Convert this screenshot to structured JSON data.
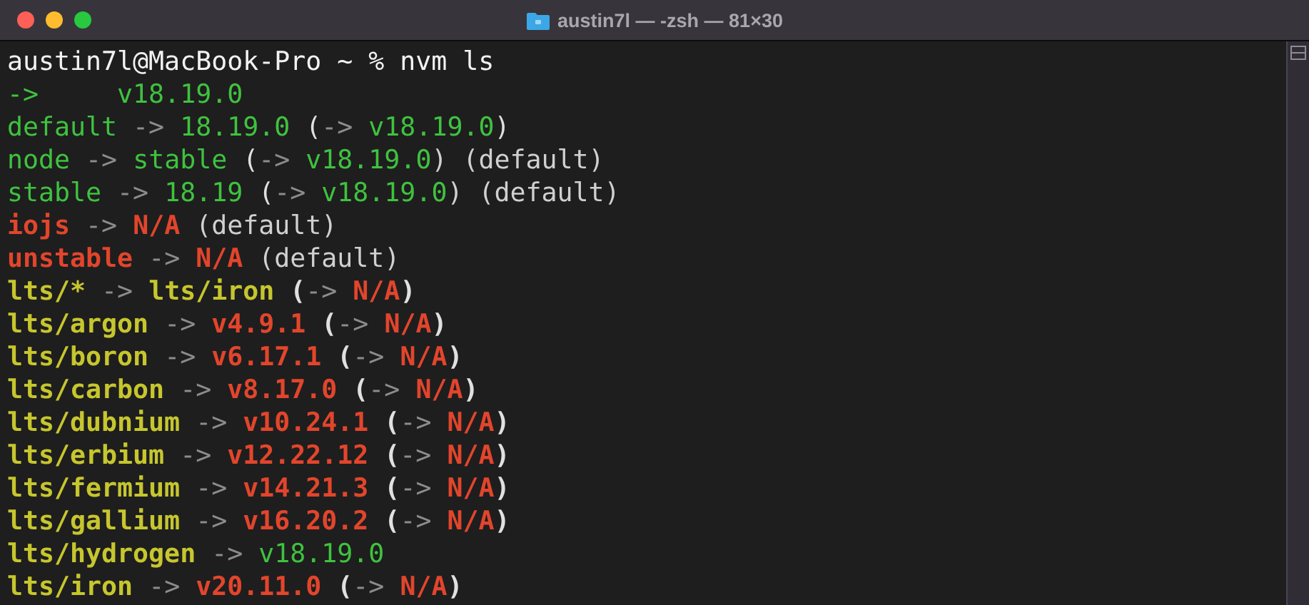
{
  "window": {
    "title": "austin7l — -zsh — 81×30"
  },
  "lines": [
    [
      {
        "text": "austin7l@MacBook-Pro ~ % nvm ls",
        "color": "#f2f2f2",
        "bold": false
      }
    ],
    [
      {
        "text": "->     v18.19.0",
        "color": "#3fc23f",
        "bold": false
      }
    ],
    [
      {
        "text": "default",
        "color": "#3fc23f",
        "bold": false
      },
      {
        "text": " -> ",
        "color": "#8c8c8c",
        "bold": false
      },
      {
        "text": "18.19.0",
        "color": "#3fc23f",
        "bold": false
      },
      {
        "text": " (",
        "color": "#e0e0e0",
        "bold": false
      },
      {
        "text": "-> ",
        "color": "#8c8c8c",
        "bold": false
      },
      {
        "text": "v18.19.0",
        "color": "#3fc23f",
        "bold": false
      },
      {
        "text": ")",
        "color": "#e0e0e0",
        "bold": false
      }
    ],
    [
      {
        "text": "node",
        "color": "#3fc23f",
        "bold": false
      },
      {
        "text": " -> ",
        "color": "#8c8c8c",
        "bold": false
      },
      {
        "text": "stable",
        "color": "#3fc23f",
        "bold": false
      },
      {
        "text": " (",
        "color": "#e0e0e0",
        "bold": false
      },
      {
        "text": "-> ",
        "color": "#8c8c8c",
        "bold": false
      },
      {
        "text": "v18.19.0",
        "color": "#3fc23f",
        "bold": false
      },
      {
        "text": ") (default)",
        "color": "#d0d0d0",
        "bold": false
      }
    ],
    [
      {
        "text": "stable",
        "color": "#3fc23f",
        "bold": false
      },
      {
        "text": " -> ",
        "color": "#8c8c8c",
        "bold": false
      },
      {
        "text": "18.19",
        "color": "#3fc23f",
        "bold": false
      },
      {
        "text": " (",
        "color": "#e0e0e0",
        "bold": false
      },
      {
        "text": "-> ",
        "color": "#8c8c8c",
        "bold": false
      },
      {
        "text": "v18.19.0",
        "color": "#3fc23f",
        "bold": false
      },
      {
        "text": ") (default)",
        "color": "#d0d0d0",
        "bold": false
      }
    ],
    [
      {
        "text": "iojs",
        "color": "#e2452c",
        "bold": true
      },
      {
        "text": " -> ",
        "color": "#8c8c8c",
        "bold": false
      },
      {
        "text": "N/A",
        "color": "#e2452c",
        "bold": true
      },
      {
        "text": " (default)",
        "color": "#d0d0d0",
        "bold": false
      }
    ],
    [
      {
        "text": "unstable",
        "color": "#e2452c",
        "bold": true
      },
      {
        "text": " -> ",
        "color": "#8c8c8c",
        "bold": false
      },
      {
        "text": "N/A",
        "color": "#e2452c",
        "bold": true
      },
      {
        "text": " (default)",
        "color": "#d0d0d0",
        "bold": false
      }
    ],
    [
      {
        "text": "lts/*",
        "color": "#c6c62e",
        "bold": true
      },
      {
        "text": " -> ",
        "color": "#8c8c8c",
        "bold": false
      },
      {
        "text": "lts/iron",
        "color": "#c6c62e",
        "bold": true
      },
      {
        "text": " (",
        "color": "#e0e0e0",
        "bold": true
      },
      {
        "text": "-> ",
        "color": "#8c8c8c",
        "bold": false
      },
      {
        "text": "N/A",
        "color": "#e2452c",
        "bold": true
      },
      {
        "text": ")",
        "color": "#e0e0e0",
        "bold": true
      }
    ],
    [
      {
        "text": "lts/argon",
        "color": "#c6c62e",
        "bold": true
      },
      {
        "text": " -> ",
        "color": "#8c8c8c",
        "bold": false
      },
      {
        "text": "v4.9.1",
        "color": "#e2452c",
        "bold": true
      },
      {
        "text": " (",
        "color": "#e0e0e0",
        "bold": true
      },
      {
        "text": "-> ",
        "color": "#8c8c8c",
        "bold": false
      },
      {
        "text": "N/A",
        "color": "#e2452c",
        "bold": true
      },
      {
        "text": ")",
        "color": "#e0e0e0",
        "bold": true
      }
    ],
    [
      {
        "text": "lts/boron",
        "color": "#c6c62e",
        "bold": true
      },
      {
        "text": " -> ",
        "color": "#8c8c8c",
        "bold": false
      },
      {
        "text": "v6.17.1",
        "color": "#e2452c",
        "bold": true
      },
      {
        "text": " (",
        "color": "#e0e0e0",
        "bold": true
      },
      {
        "text": "-> ",
        "color": "#8c8c8c",
        "bold": false
      },
      {
        "text": "N/A",
        "color": "#e2452c",
        "bold": true
      },
      {
        "text": ")",
        "color": "#e0e0e0",
        "bold": true
      }
    ],
    [
      {
        "text": "lts/carbon",
        "color": "#c6c62e",
        "bold": true
      },
      {
        "text": " -> ",
        "color": "#8c8c8c",
        "bold": false
      },
      {
        "text": "v8.17.0",
        "color": "#e2452c",
        "bold": true
      },
      {
        "text": " (",
        "color": "#e0e0e0",
        "bold": true
      },
      {
        "text": "-> ",
        "color": "#8c8c8c",
        "bold": false
      },
      {
        "text": "N/A",
        "color": "#e2452c",
        "bold": true
      },
      {
        "text": ")",
        "color": "#e0e0e0",
        "bold": true
      }
    ],
    [
      {
        "text": "lts/dubnium",
        "color": "#c6c62e",
        "bold": true
      },
      {
        "text": " -> ",
        "color": "#8c8c8c",
        "bold": false
      },
      {
        "text": "v10.24.1",
        "color": "#e2452c",
        "bold": true
      },
      {
        "text": " (",
        "color": "#e0e0e0",
        "bold": true
      },
      {
        "text": "-> ",
        "color": "#8c8c8c",
        "bold": false
      },
      {
        "text": "N/A",
        "color": "#e2452c",
        "bold": true
      },
      {
        "text": ")",
        "color": "#e0e0e0",
        "bold": true
      }
    ],
    [
      {
        "text": "lts/erbium",
        "color": "#c6c62e",
        "bold": true
      },
      {
        "text": " -> ",
        "color": "#8c8c8c",
        "bold": false
      },
      {
        "text": "v12.22.12",
        "color": "#e2452c",
        "bold": true
      },
      {
        "text": " (",
        "color": "#e0e0e0",
        "bold": true
      },
      {
        "text": "-> ",
        "color": "#8c8c8c",
        "bold": false
      },
      {
        "text": "N/A",
        "color": "#e2452c",
        "bold": true
      },
      {
        "text": ")",
        "color": "#e0e0e0",
        "bold": true
      }
    ],
    [
      {
        "text": "lts/fermium",
        "color": "#c6c62e",
        "bold": true
      },
      {
        "text": " -> ",
        "color": "#8c8c8c",
        "bold": false
      },
      {
        "text": "v14.21.3",
        "color": "#e2452c",
        "bold": true
      },
      {
        "text": " (",
        "color": "#e0e0e0",
        "bold": true
      },
      {
        "text": "-> ",
        "color": "#8c8c8c",
        "bold": false
      },
      {
        "text": "N/A",
        "color": "#e2452c",
        "bold": true
      },
      {
        "text": ")",
        "color": "#e0e0e0",
        "bold": true
      }
    ],
    [
      {
        "text": "lts/gallium",
        "color": "#c6c62e",
        "bold": true
      },
      {
        "text": " -> ",
        "color": "#8c8c8c",
        "bold": false
      },
      {
        "text": "v16.20.2",
        "color": "#e2452c",
        "bold": true
      },
      {
        "text": " (",
        "color": "#e0e0e0",
        "bold": true
      },
      {
        "text": "-> ",
        "color": "#8c8c8c",
        "bold": false
      },
      {
        "text": "N/A",
        "color": "#e2452c",
        "bold": true
      },
      {
        "text": ")",
        "color": "#e0e0e0",
        "bold": true
      }
    ],
    [
      {
        "text": "lts/hydrogen",
        "color": "#c6c62e",
        "bold": true
      },
      {
        "text": " -> ",
        "color": "#8c8c8c",
        "bold": false
      },
      {
        "text": "v18.19.0",
        "color": "#3fc23f",
        "bold": false
      }
    ],
    [
      {
        "text": "lts/iron",
        "color": "#c6c62e",
        "bold": true
      },
      {
        "text": " -> ",
        "color": "#8c8c8c",
        "bold": false
      },
      {
        "text": "v20.11.0",
        "color": "#e2452c",
        "bold": true
      },
      {
        "text": " (",
        "color": "#e0e0e0",
        "bold": true
      },
      {
        "text": "-> ",
        "color": "#8c8c8c",
        "bold": false
      },
      {
        "text": "N/A",
        "color": "#e2452c",
        "bold": true
      },
      {
        "text": ")",
        "color": "#e0e0e0",
        "bold": true
      }
    ]
  ]
}
